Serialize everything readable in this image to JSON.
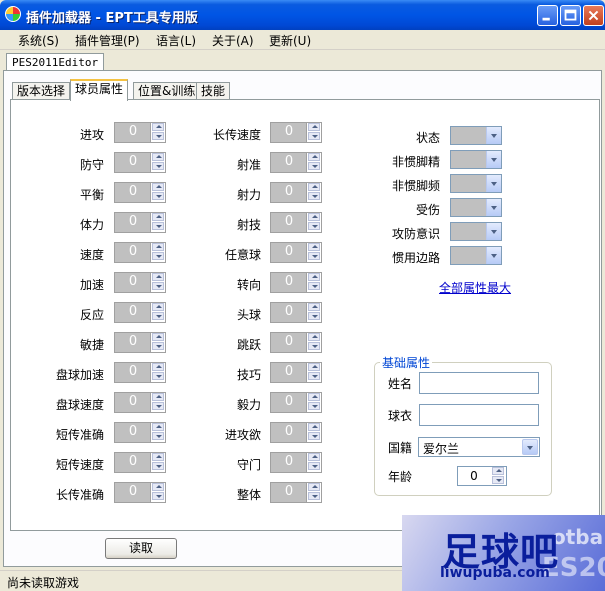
{
  "window": {
    "title": "插件加载器 - EPT工具专用版"
  },
  "menu": [
    "系统(S)",
    "插件管理(P)",
    "语言(L)",
    "关于(A)",
    "更新(U)"
  ],
  "outer_tab": "PES2011Editor",
  "tabs": [
    "版本选择",
    "球员属性",
    "位置&训练",
    "技能"
  ],
  "active_tab": "球员属性",
  "attributes_col1": [
    {
      "label": "进攻",
      "value": "0"
    },
    {
      "label": "防守",
      "value": "0"
    },
    {
      "label": "平衡",
      "value": "0"
    },
    {
      "label": "体力",
      "value": "0"
    },
    {
      "label": "速度",
      "value": "0"
    },
    {
      "label": "加速",
      "value": "0"
    },
    {
      "label": "反应",
      "value": "0"
    },
    {
      "label": "敏捷",
      "value": "0"
    },
    {
      "label": "盘球加速",
      "value": "0"
    },
    {
      "label": "盘球速度",
      "value": "0"
    },
    {
      "label": "短传准确",
      "value": "0"
    },
    {
      "label": "短传速度",
      "value": "0"
    },
    {
      "label": "长传准确",
      "value": "0"
    }
  ],
  "attributes_col2": [
    {
      "label": "长传速度",
      "value": "0"
    },
    {
      "label": "射准",
      "value": "0"
    },
    {
      "label": "射力",
      "value": "0"
    },
    {
      "label": "射技",
      "value": "0"
    },
    {
      "label": "任意球",
      "value": "0"
    },
    {
      "label": "转向",
      "value": "0"
    },
    {
      "label": "头球",
      "value": "0"
    },
    {
      "label": "跳跃",
      "value": "0"
    },
    {
      "label": "技巧",
      "value": "0"
    },
    {
      "label": "毅力",
      "value": "0"
    },
    {
      "label": "进攻欲",
      "value": "0"
    },
    {
      "label": "守门",
      "value": "0"
    },
    {
      "label": "整体",
      "value": "0"
    }
  ],
  "attributes_col3": [
    {
      "label": "状态"
    },
    {
      "label": "非惯脚精"
    },
    {
      "label": "非惯脚频"
    },
    {
      "label": "受伤"
    },
    {
      "label": "攻防意识"
    },
    {
      "label": "惯用边路"
    }
  ],
  "max_all_link": "全部属性最大",
  "basic": {
    "title": "基础属性",
    "name_label": "姓名",
    "name_value": "",
    "shirt_label": "球衣",
    "shirt_value": "",
    "nationality_label": "国籍",
    "nationality_value": "爱尔兰",
    "age_label": "年龄",
    "age_value": "0"
  },
  "read_button": "读取",
  "status": "尚未读取游戏",
  "watermark": {
    "main": "足球吧",
    "url": "liwupuba.com",
    "side1": "otba",
    "side2": "ES20"
  },
  "colors": {
    "titlebar": "#0055E5",
    "spin_bg": "#C0C0C0",
    "link": "#0000CC",
    "group_title": "#0046D5"
  }
}
